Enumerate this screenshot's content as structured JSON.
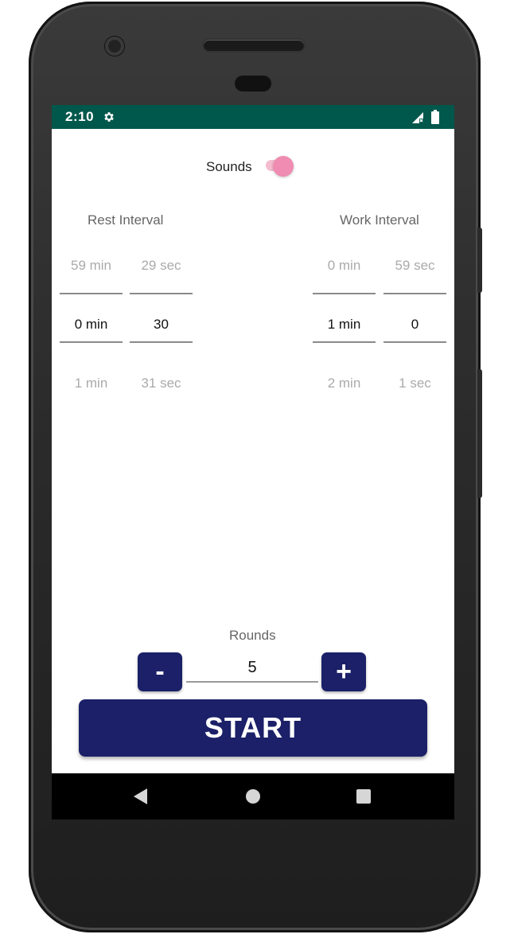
{
  "status_bar": {
    "time": "2:10",
    "background_color": "#00574b",
    "icons": [
      "gear-icon",
      "signal-icon",
      "battery-icon"
    ]
  },
  "sounds": {
    "label": "Sounds",
    "enabled": true,
    "toggle_color": "#f08cb1"
  },
  "rest_interval": {
    "label": "Rest Interval",
    "minutes": {
      "above": "59 min",
      "selected": "0 min",
      "below": "1 min"
    },
    "seconds": {
      "above": "29 sec",
      "selected": "30",
      "below": "31 sec"
    }
  },
  "work_interval": {
    "label": "Work Interval",
    "minutes": {
      "above": "0 min",
      "selected": "1 min",
      "below": "2 min"
    },
    "seconds": {
      "above": "59 sec",
      "selected": "0",
      "below": "1 sec"
    }
  },
  "rounds": {
    "label": "Rounds",
    "value": "5",
    "minus_label": "-",
    "plus_label": "+"
  },
  "start_button": {
    "label": "START"
  },
  "theme": {
    "primary": "#1b2068"
  },
  "nav_bar": {
    "icons": [
      "back-icon",
      "home-icon",
      "recents-icon"
    ]
  }
}
